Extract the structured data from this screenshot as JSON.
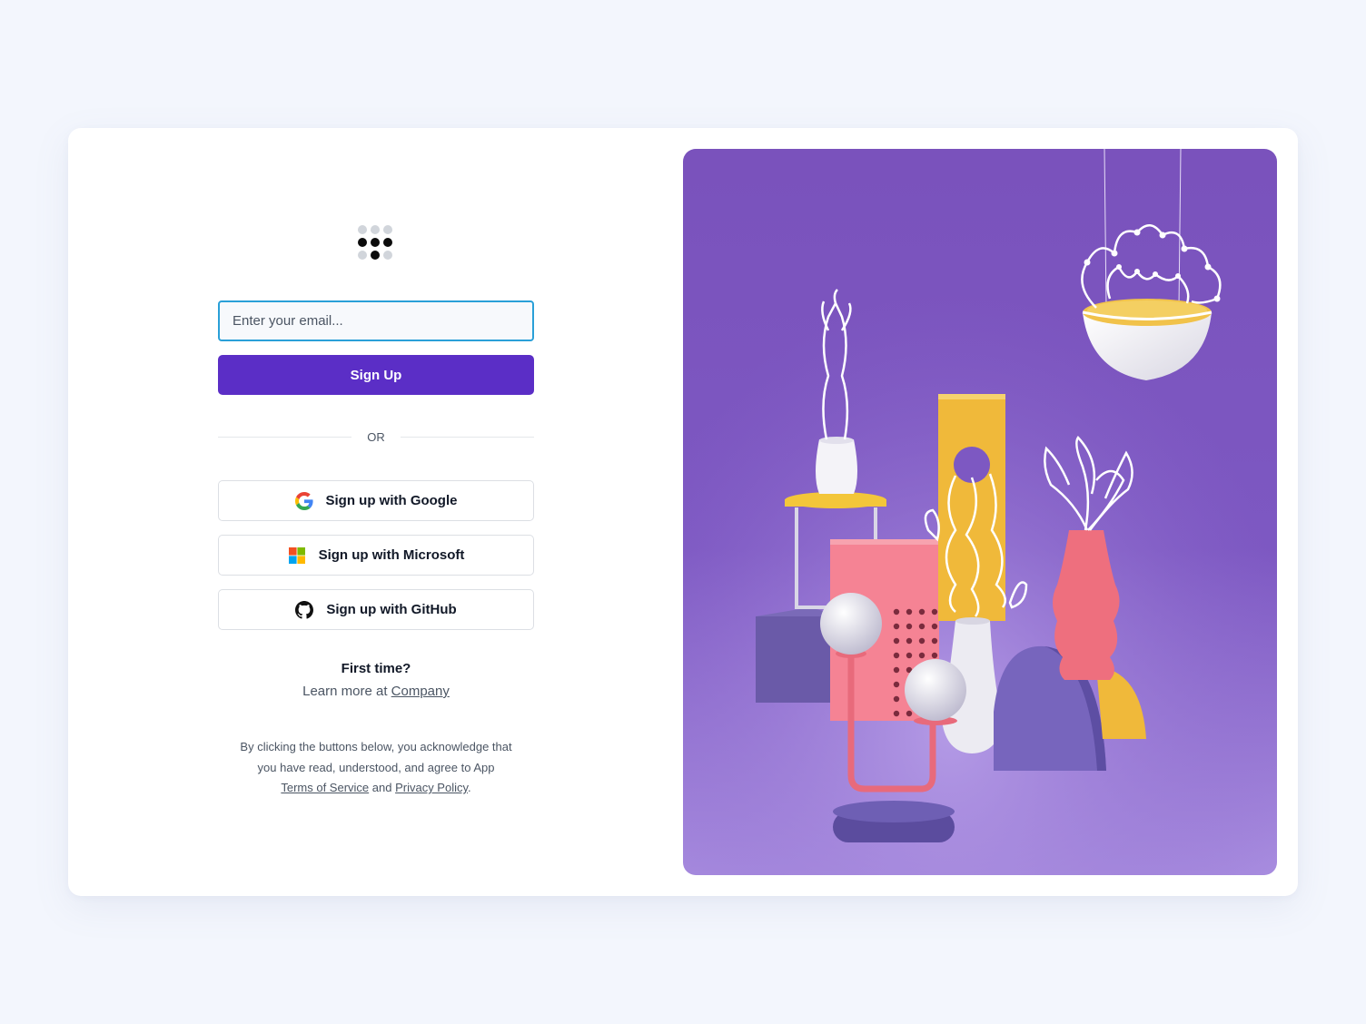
{
  "logo": {
    "icon": "dot-grid-logo"
  },
  "signup": {
    "email_placeholder": "Enter your email...",
    "submit_label": "Sign Up",
    "divider_text": "OR"
  },
  "social": [
    {
      "label": "Sign up with Google",
      "icon": "google-icon"
    },
    {
      "label": "Sign up with Microsoft",
      "icon": "microsoft-icon"
    },
    {
      "label": "Sign up with GitHub",
      "icon": "github-icon"
    }
  ],
  "first_time": {
    "heading": "First time?",
    "learn_prefix": "Learn more at ",
    "company_link": "Company"
  },
  "legal": {
    "line1": "By clicking the buttons below, you acknowledge that",
    "line2": "you have read, understood, and agree to App",
    "terms_link": "Terms of Service",
    "and_text": " and ",
    "privacy_link": "Privacy Policy",
    "end": "."
  },
  "colors": {
    "page_bg": "#f3f6fd",
    "accent": "#5b2ec6",
    "input_focus": "#2aa0d8",
    "illustration_bg": "#7c55be"
  }
}
